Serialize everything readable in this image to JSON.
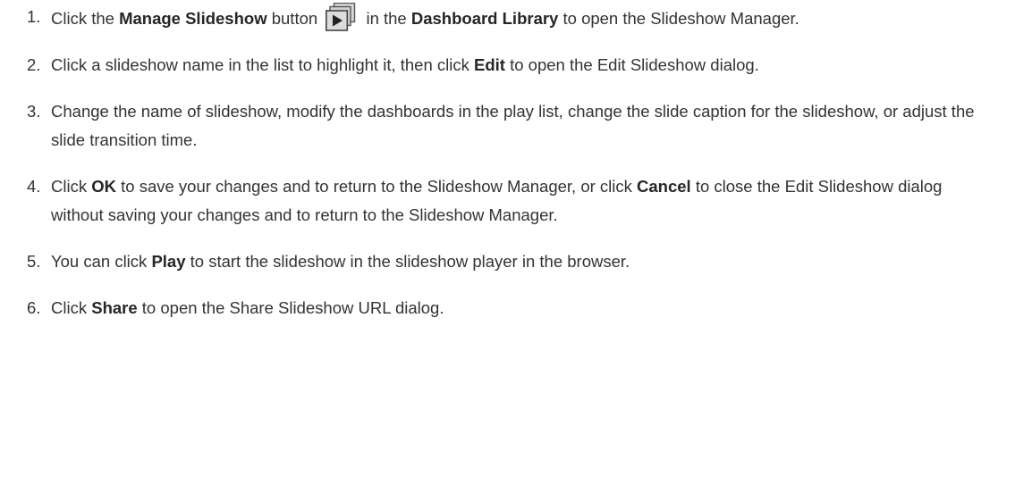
{
  "steps": [
    {
      "number": "1.",
      "parts": [
        "Click the ",
        "Manage Slideshow",
        " button ",
        " in the ",
        "Dashboard Library",
        " to open the Slideshow Manager."
      ]
    },
    {
      "number": "2.",
      "parts": [
        "Click a slideshow name in the list to highlight it, then click ",
        "Edit",
        " to open the Edit Slideshow dialog."
      ]
    },
    {
      "number": "3.",
      "text": "Change the name of slideshow, modify the dashboards in the play list, change the slide caption for the slideshow, or adjust the slide transition time."
    },
    {
      "number": "4.",
      "parts": [
        "Click ",
        "OK",
        " to save your changes and to return to the Slideshow Manager, or click ",
        "Cancel",
        " to close the Edit Slideshow dialog without saving your changes and to return to the Slideshow Manager."
      ]
    },
    {
      "number": "5.",
      "parts": [
        "You can click ",
        "Play",
        " to start the slideshow in the slideshow player in the browser."
      ]
    },
    {
      "number": "6.",
      "parts": [
        "Click ",
        "Share",
        " to open the Share Slideshow URL dialog."
      ]
    }
  ],
  "icons": {
    "manage_slideshow": "manage-slideshow-icon"
  }
}
